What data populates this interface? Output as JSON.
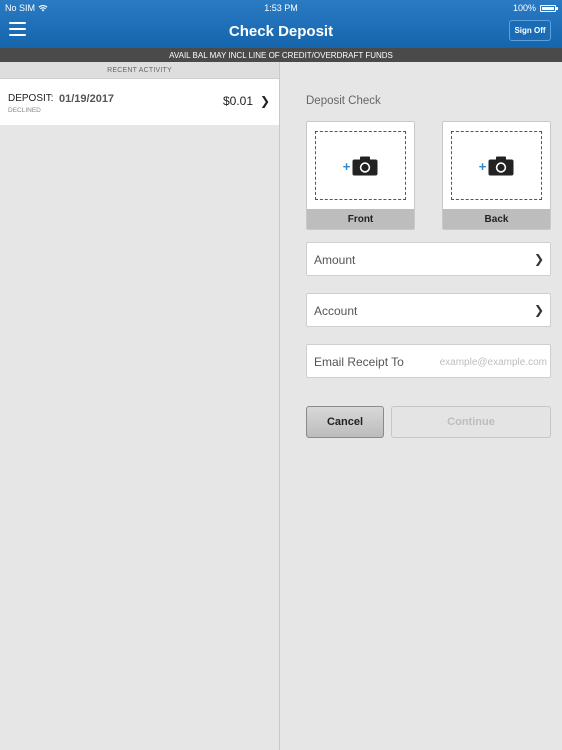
{
  "status_bar": {
    "carrier": "No SIM",
    "time": "1:53 PM",
    "battery": "100%"
  },
  "header": {
    "title": "Check Deposit",
    "sign_off_label": "Sign Off"
  },
  "notice": "AVAIL BAL MAY INCL LINE OF CREDIT/OVERDRAFT FUNDS",
  "recent_activity": {
    "header": "RECENT ACTIVITY",
    "items": [
      {
        "type": "DEPOSIT:",
        "date": "01/19/2017",
        "status": "DECLINED",
        "amount": "$0.01"
      }
    ]
  },
  "deposit": {
    "section_label": "Deposit Check",
    "front_label": "Front",
    "back_label": "Back",
    "amount_label": "Amount",
    "account_label": "Account",
    "email_label": "Email Receipt To",
    "email_value": "",
    "email_placeholder": "example@example.com",
    "cancel_label": "Cancel",
    "continue_label": "Continue"
  },
  "colors": {
    "header_blue": "#1a6cb6",
    "accent_blue": "#2a86d6",
    "notice_bg": "#4a4a4a"
  },
  "icons": {
    "menu": "hamburger-menu-icon",
    "wifi": "wifi-icon",
    "battery": "battery-icon",
    "camera": "camera-icon",
    "chevron": "chevron-right-icon"
  }
}
